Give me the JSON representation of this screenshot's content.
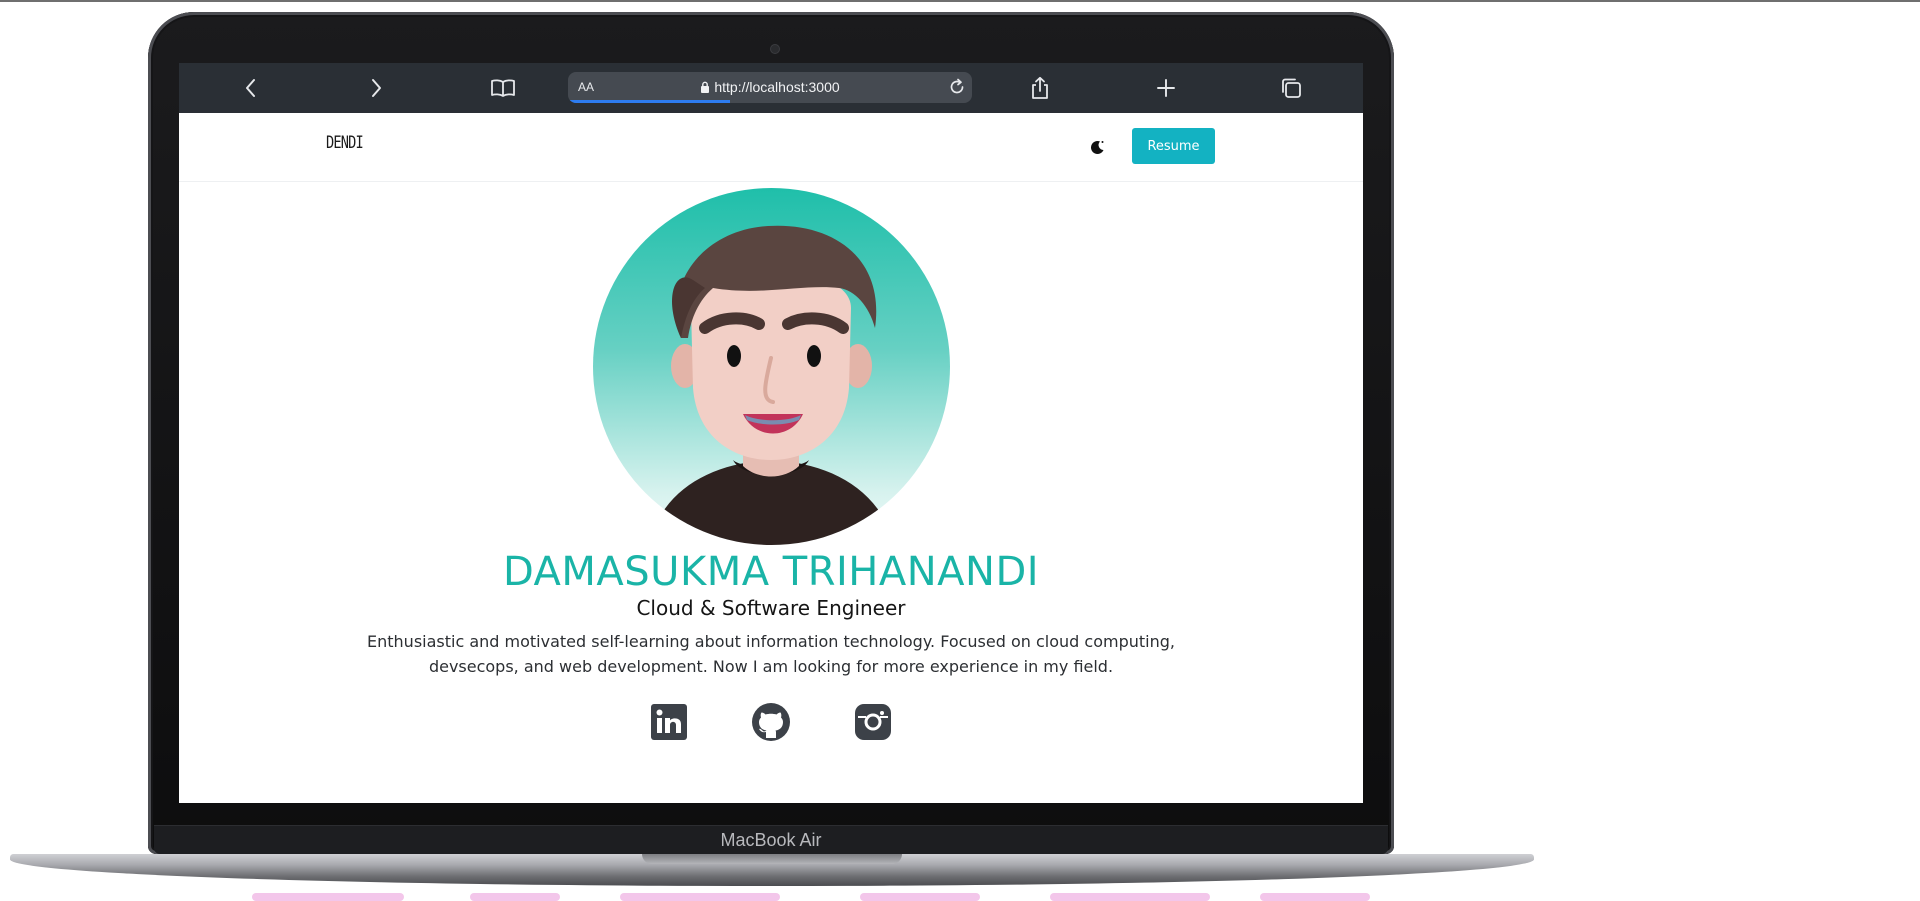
{
  "browser": {
    "text_size_label": "AA",
    "url": "http://localhost:3000",
    "load_progress": 0.4
  },
  "site": {
    "logo": "DENDI",
    "resume_label": "Resume"
  },
  "hero": {
    "name": "DAMASUKMA TRIHANANDI",
    "role": "Cloud & Software Engineer",
    "bio": "Enthusiastic and motivated self-learning about information technology. Focused on cloud computing, devsecops, and web development. Now I am looking for more experience in my field."
  },
  "social": [
    "linkedin-icon",
    "github-icon",
    "instagram-icon"
  ],
  "device": {
    "model_label": "MacBook Air"
  },
  "colors": {
    "accent": "#1ab4a7",
    "button": "#13b2c2",
    "browser_bar": "#2a2f35"
  }
}
